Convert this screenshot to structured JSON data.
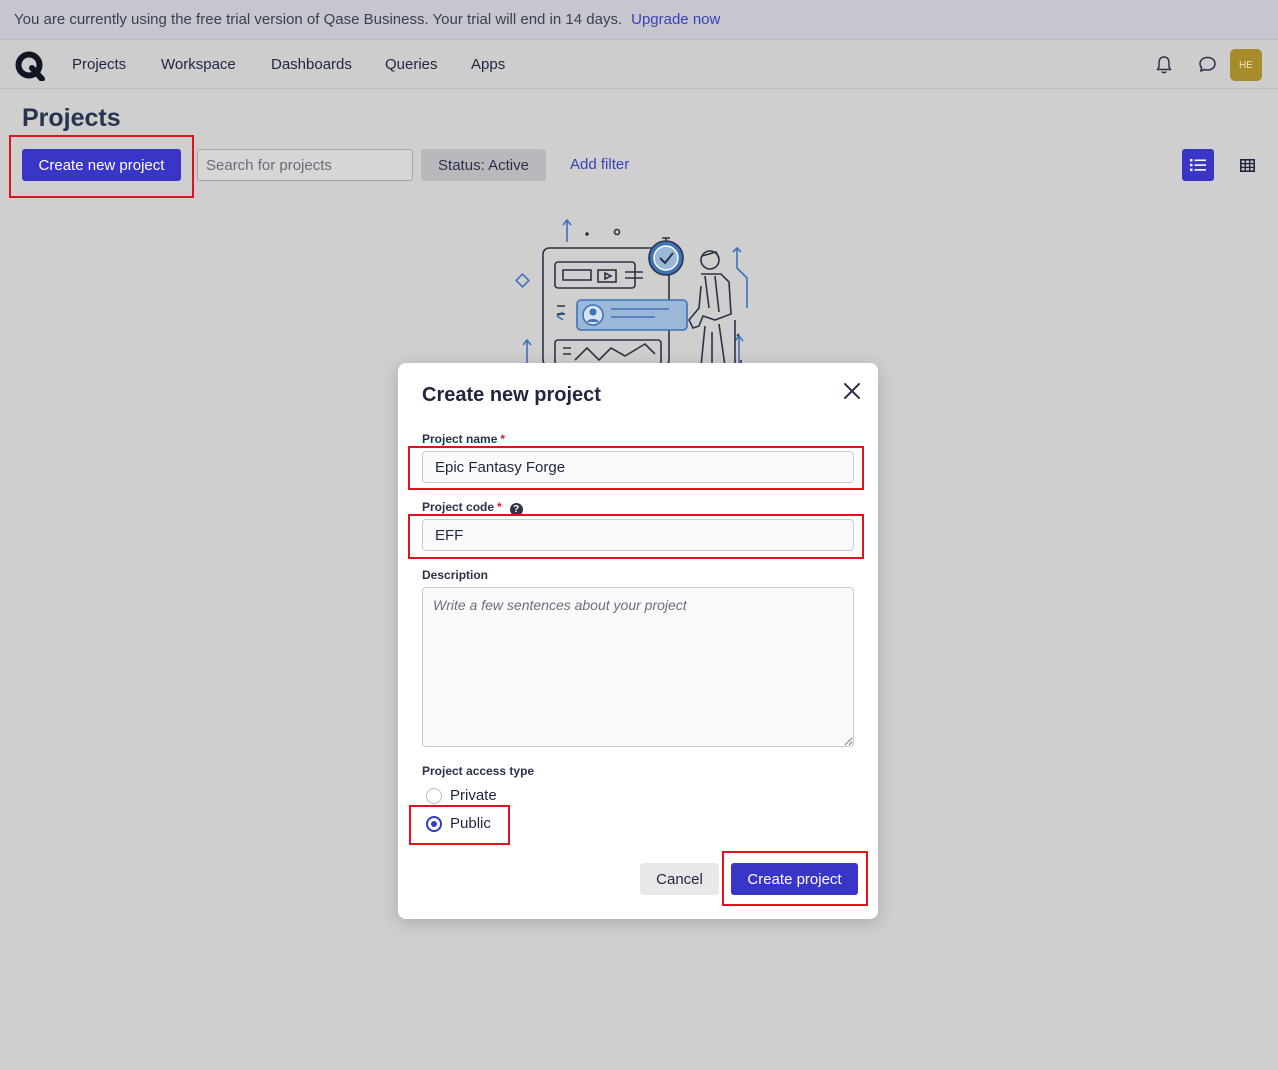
{
  "banner": {
    "message": "You are currently using the free trial version of Qase Business.  Your trial will end in 14 days.",
    "upgrade_link": "Upgrade now"
  },
  "nav": {
    "items": [
      "Projects",
      "Workspace",
      "Dashboards",
      "Queries",
      "Apps"
    ],
    "avatar_initials": "HE"
  },
  "page": {
    "title": "Projects",
    "create_button": "Create new project",
    "search_placeholder": "Search for projects",
    "status_filter": "Status: Active",
    "add_filter": "Add filter"
  },
  "modal": {
    "title": "Create new project",
    "project_name_label": "Project name",
    "project_name_value": "Epic Fantasy Forge",
    "project_code_label": "Project code",
    "project_code_value": "EFF",
    "required_mark": "*",
    "help_mark": "?",
    "description_label": "Description",
    "description_placeholder": "Write a few sentences about your project",
    "access_type_label": "Project access type",
    "access_options": [
      "Private",
      "Public"
    ],
    "selected_access": "Public",
    "cancel_button": "Cancel",
    "create_button": "Create project"
  },
  "colors": {
    "primary": "#3935c6",
    "highlight": "#e0121c",
    "link": "#3a42b8"
  }
}
